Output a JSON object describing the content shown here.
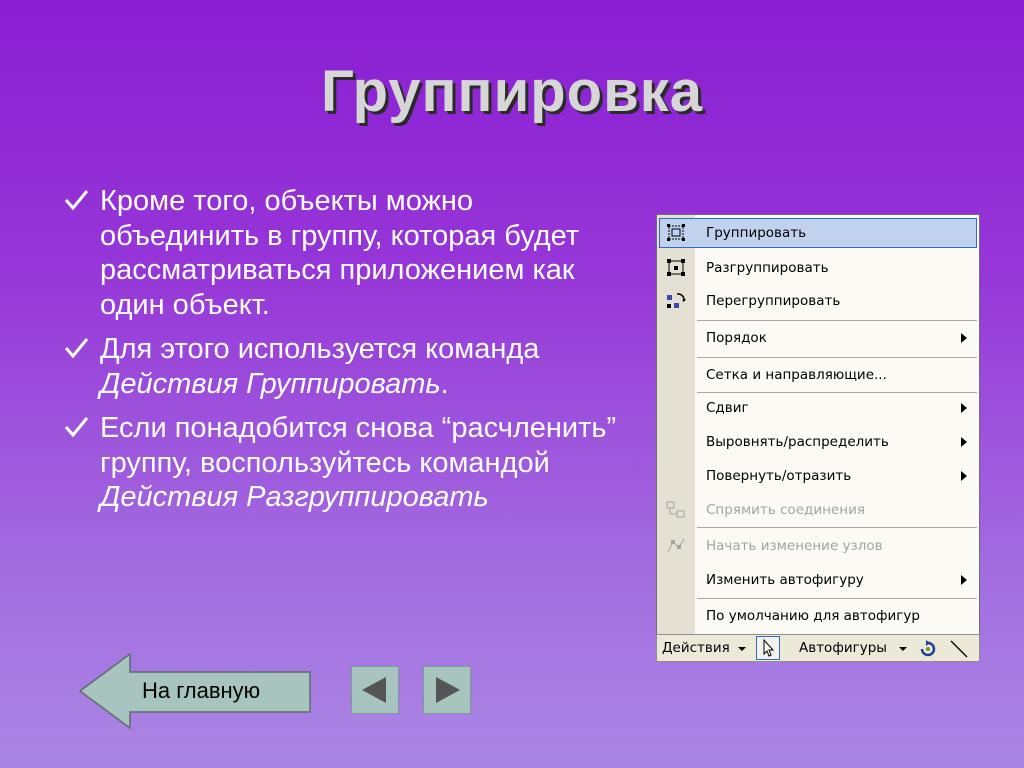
{
  "slide": {
    "title": "Группировка",
    "bullets": [
      {
        "text": "Кроме того, объекты можно объединить в группу, которая будет рассматриваться приложением как один объект."
      },
      {
        "text": "Для этого используется команда ",
        "italic": "Действия Группировать",
        "after": "."
      },
      {
        "text": "Если понадобится снова “расчленить” группу, воспользуйтесь командой ",
        "italic": "Действия Разгруппировать"
      }
    ]
  },
  "menu": {
    "items": [
      {
        "label": "Группировать",
        "icon": "group-icon"
      },
      {
        "label": "Разгруппировать",
        "icon": "ungroup-icon"
      },
      {
        "label": "Перегруппировать",
        "icon": "regroup-icon"
      },
      {
        "label": "Порядок"
      },
      {
        "label": "Сетка и направляющие..."
      },
      {
        "label": "Сдвиг"
      },
      {
        "label": "Выровнять/распределить"
      },
      {
        "label": "Повернуть/отразить"
      },
      {
        "label": "Спрямить соединения",
        "icon": "straighten-connectors-icon"
      },
      {
        "label": "Начать изменение узлов",
        "icon": "edit-points-icon"
      },
      {
        "label": "Изменить автофигуру"
      },
      {
        "label": "По умолчанию для автофигур"
      }
    ]
  },
  "toolbar": {
    "actions_label": "Действия",
    "autoshapes_label": "Автофигуры"
  },
  "nav": {
    "home_label": "На главную",
    "prev_icon": "triangle-left-icon",
    "next_icon": "triangle-right-icon"
  },
  "colors": {
    "background_top": "#8a1ed2",
    "background_bottom": "#aa86e4",
    "button_fill": "#a7c4be",
    "triangle_fill": "#555555"
  }
}
